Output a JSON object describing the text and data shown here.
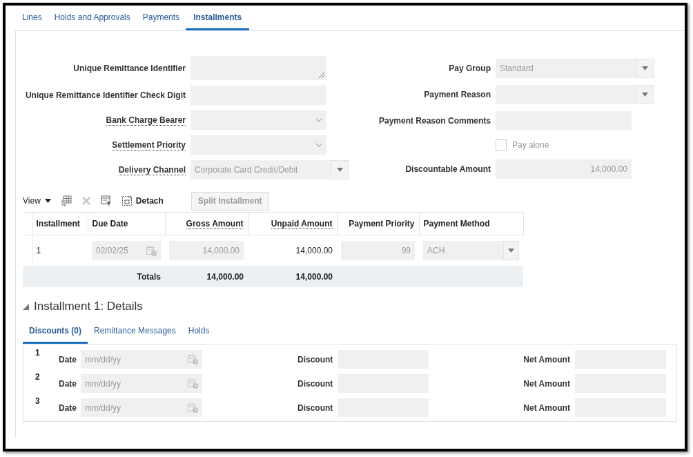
{
  "tabs": [
    {
      "label": "Lines",
      "selected": false
    },
    {
      "label": "Holds and Approvals",
      "selected": false
    },
    {
      "label": "Payments",
      "selected": false
    },
    {
      "label": "Installments",
      "selected": true
    }
  ],
  "form": {
    "left": [
      {
        "label": "Unique Remittance Identifier",
        "help": false,
        "kind": "textarea"
      },
      {
        "label": "Unique Remittance Identifier Check Digit",
        "help": false,
        "kind": "text"
      },
      {
        "label": "Bank Charge Bearer",
        "help": true,
        "kind": "select"
      },
      {
        "label": "Settlement Priority",
        "help": true,
        "kind": "select"
      },
      {
        "label": "Delivery Channel",
        "help": true,
        "kind": "choice",
        "value": "Corporate Card Credit/Debit"
      }
    ],
    "right": [
      {
        "label": "Pay Group",
        "help": false,
        "kind": "choice",
        "value": "Standard"
      },
      {
        "label": "Payment Reason",
        "help": false,
        "kind": "choice"
      },
      {
        "label": "Payment Reason Comments",
        "help": false,
        "kind": "text"
      },
      {
        "label": "Pay alone",
        "kind": "checkbox",
        "checked": false
      },
      {
        "label": "Discountable Amount",
        "help": false,
        "kind": "amount",
        "value": "14,000.00"
      }
    ]
  },
  "toolbar": {
    "view_menu": "View",
    "delete_disabled": true,
    "detach": "Detach",
    "split_button": {
      "label": "Split Installment",
      "disabled": true
    }
  },
  "table": {
    "columns": [
      {
        "label": "Installment",
        "help": false
      },
      {
        "label": "Due Date",
        "help": false
      },
      {
        "label": "Gross Amount",
        "help": true
      },
      {
        "label": "Unpaid Amount",
        "help": true
      },
      {
        "label": "Payment Priority",
        "help": false
      },
      {
        "label": "Payment Method",
        "help": false
      }
    ],
    "rows": [
      {
        "installment": "1",
        "due_date": "02/02/25",
        "gross_amount": "14,000.00",
        "unpaid_amount": "14,000.00",
        "payment_priority": "99",
        "payment_method": "ACH"
      }
    ],
    "totals": {
      "label": "Totals",
      "gross_amount": "14,000.00",
      "unpaid_amount": "14,000.00"
    }
  },
  "details": {
    "title": "Installment 1: Details",
    "expanded": true,
    "tabs": [
      {
        "label": "Discounts (0)",
        "selected": true
      },
      {
        "label": "Remittance Messages",
        "selected": false
      },
      {
        "label": "Holds",
        "selected": false
      }
    ],
    "discounts": [
      {
        "number": "1",
        "date_label": "Date",
        "date_placeholder": "mm/dd/yy",
        "discount_label": "Discount",
        "net_label": "Net Amount"
      },
      {
        "number": "2",
        "date_label": "Date",
        "date_placeholder": "mm/dd/yy",
        "discount_label": "Discount",
        "net_label": "Net Amount"
      },
      {
        "number": "3",
        "date_label": "Date",
        "date_placeholder": "mm/dd/yy",
        "discount_label": "Discount",
        "net_label": "Net Amount"
      }
    ]
  }
}
